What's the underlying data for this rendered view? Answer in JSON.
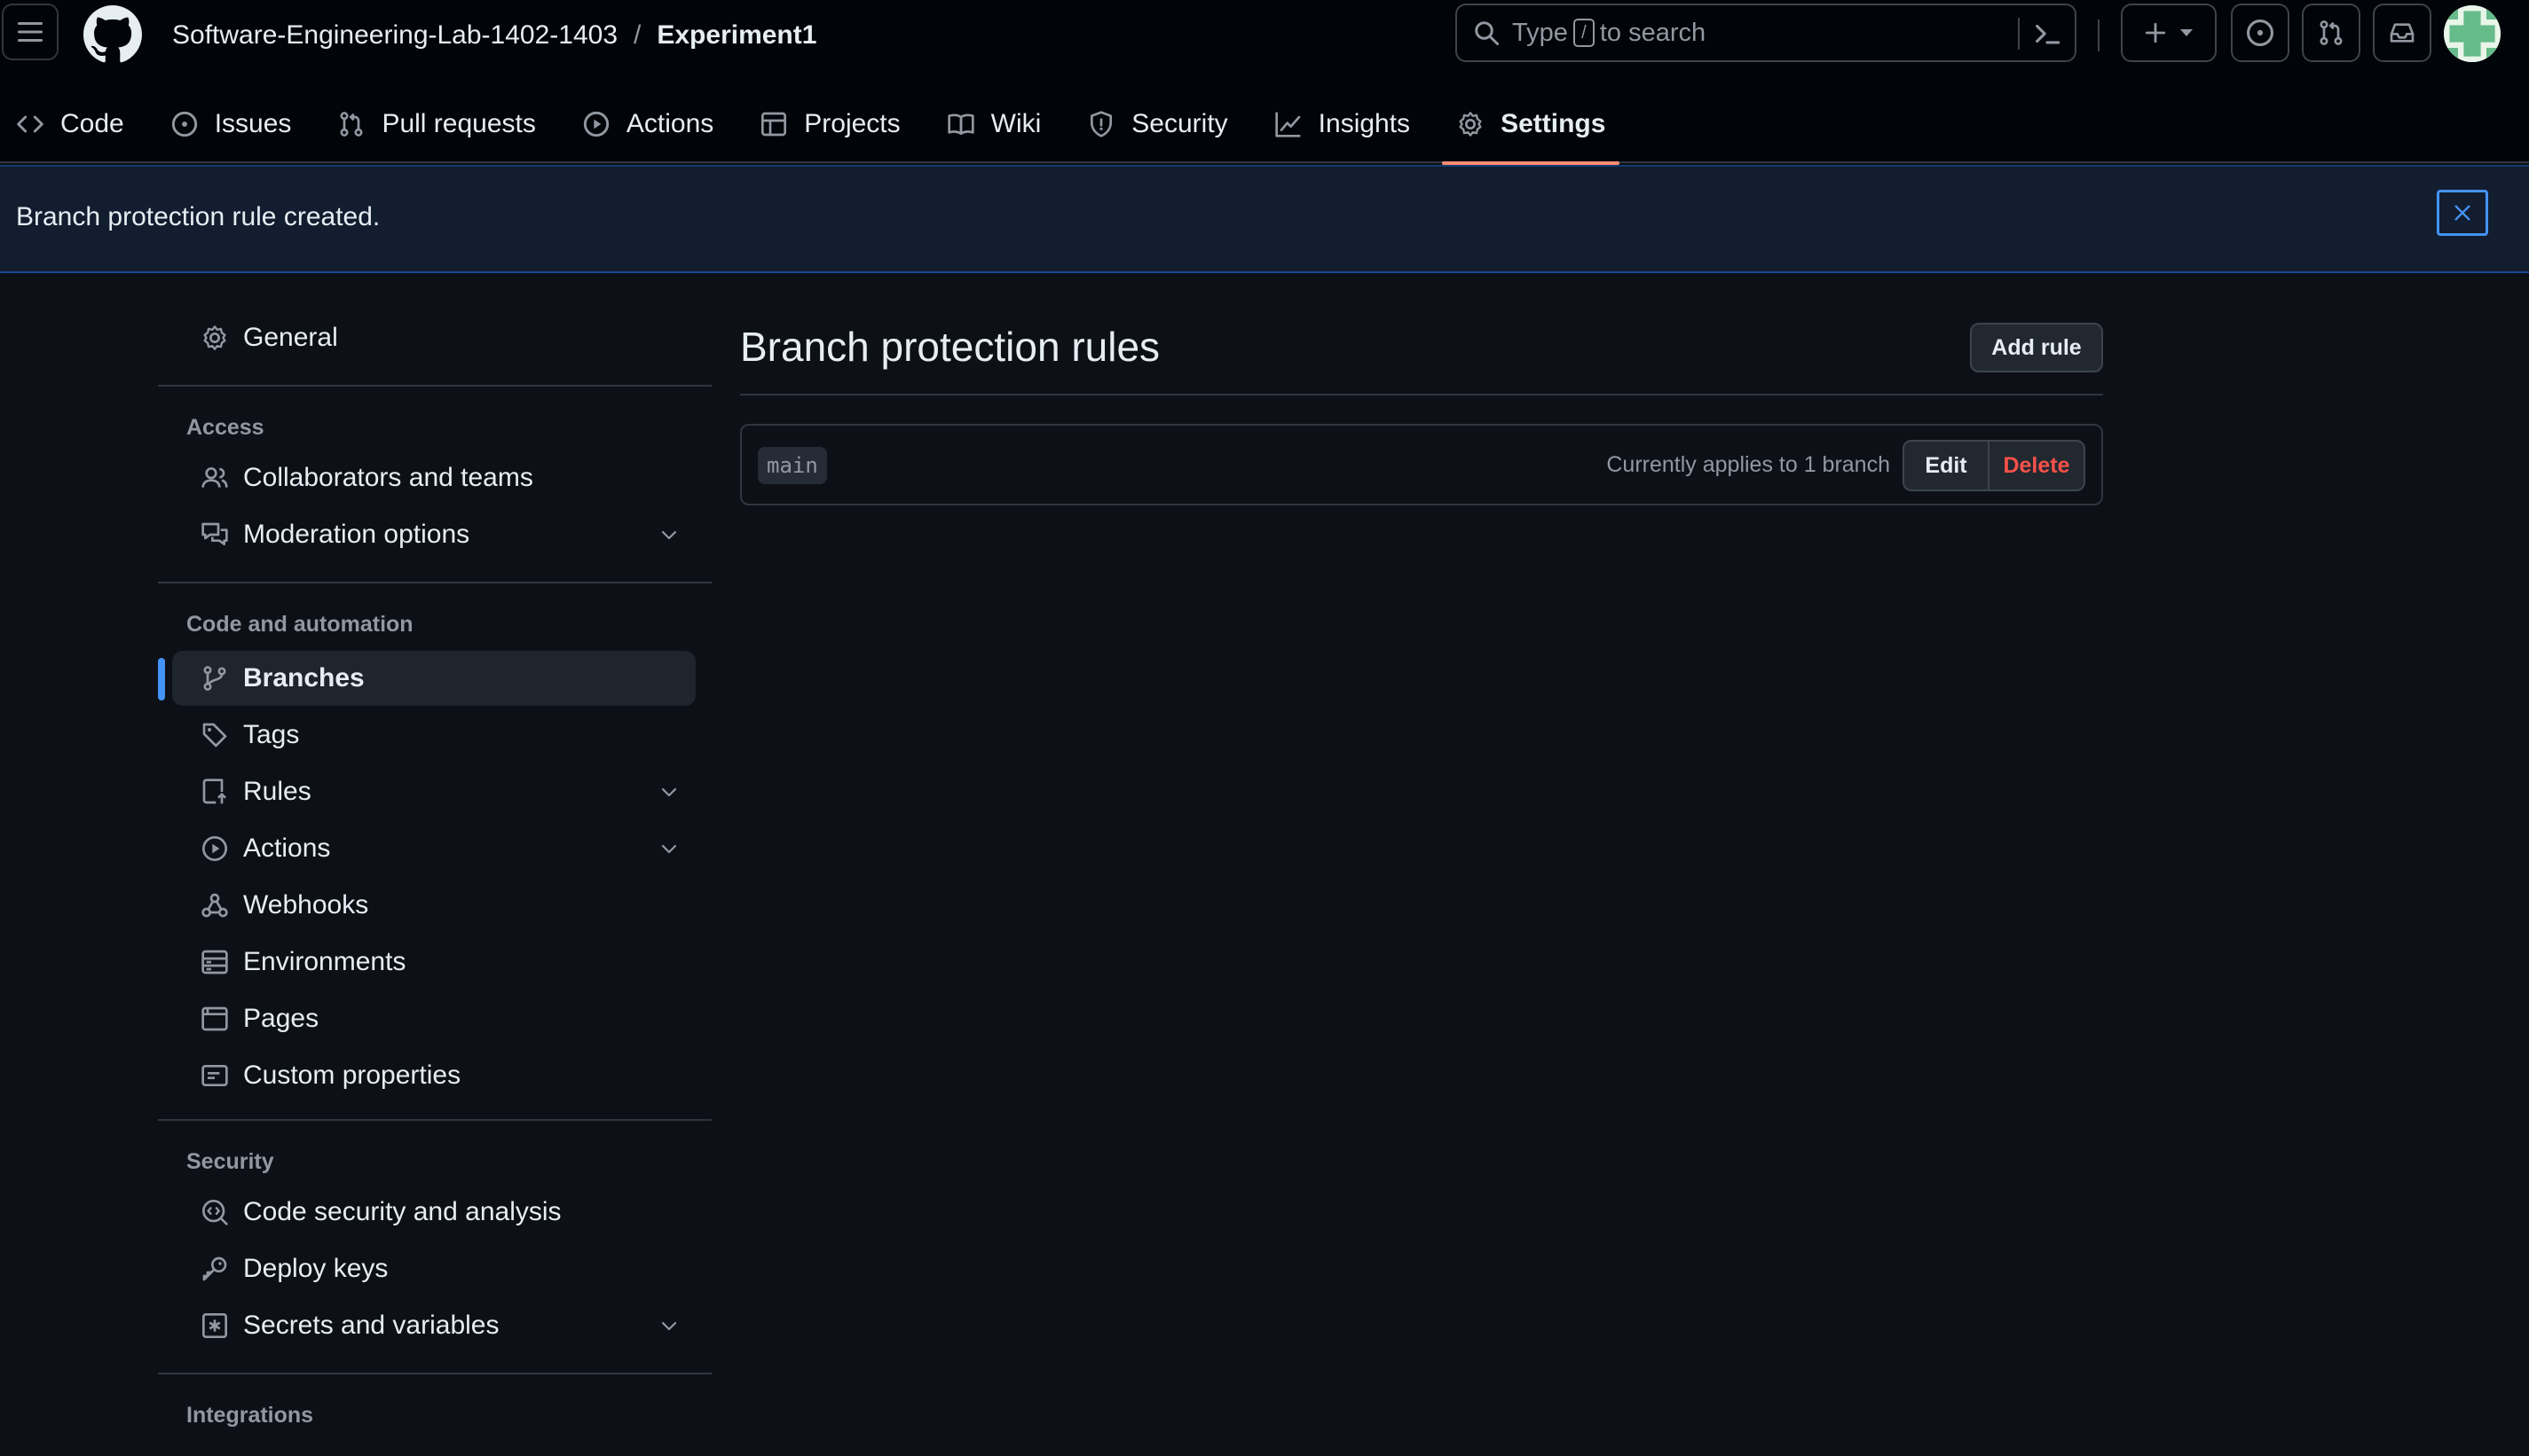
{
  "header": {
    "owner": "Software-Engineering-Lab-1402-1403",
    "separator": "/",
    "repo": "Experiment1",
    "search": {
      "prefix": "Type",
      "key": "/",
      "suffix": "to search"
    }
  },
  "nav": {
    "items": [
      {
        "label": "Code",
        "icon": "code-icon"
      },
      {
        "label": "Issues",
        "icon": "issue-opened-icon"
      },
      {
        "label": "Pull requests",
        "icon": "git-pull-request-icon"
      },
      {
        "label": "Actions",
        "icon": "play-icon"
      },
      {
        "label": "Projects",
        "icon": "table-icon"
      },
      {
        "label": "Wiki",
        "icon": "book-icon"
      },
      {
        "label": "Security",
        "icon": "shield-icon"
      },
      {
        "label": "Insights",
        "icon": "graph-icon"
      },
      {
        "label": "Settings",
        "icon": "gear-icon",
        "active": true
      }
    ]
  },
  "flash": {
    "message": "Branch protection rule created."
  },
  "sidebar": {
    "general": "General",
    "sections": {
      "access": "Access",
      "code_automation": "Code and automation",
      "security": "Security",
      "integrations": "Integrations"
    },
    "items": {
      "collaborators": "Collaborators and teams",
      "moderation": "Moderation options",
      "branches": "Branches",
      "tags": "Tags",
      "rules": "Rules",
      "actions": "Actions",
      "webhooks": "Webhooks",
      "environments": "Environments",
      "pages": "Pages",
      "custom_properties": "Custom properties",
      "code_security": "Code security and analysis",
      "deploy_keys": "Deploy keys",
      "secrets": "Secrets and variables"
    },
    "active_item": "Branches"
  },
  "main": {
    "title": "Branch protection rules",
    "add_rule_label": "Add rule",
    "rules": [
      {
        "pattern": "main",
        "applies": "Currently applies to 1 branch",
        "edit_label": "Edit",
        "delete_label": "Delete"
      }
    ]
  },
  "colors": {
    "background": "#0d1117",
    "header_bg": "#010409",
    "accent_blue": "#4493f8",
    "active_tab_underline": "#fd8c73",
    "danger": "#f85149"
  }
}
